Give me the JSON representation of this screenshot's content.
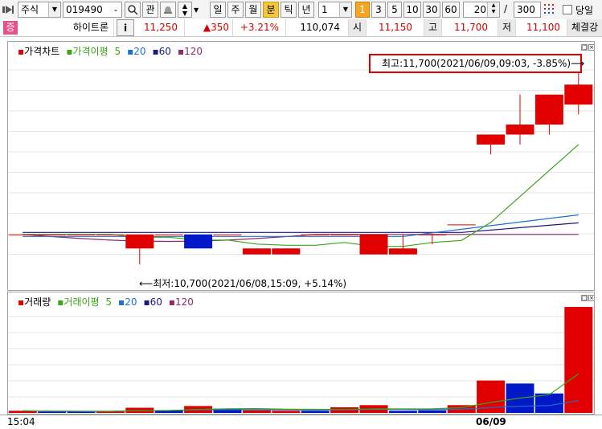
{
  "toolbar": {
    "market": "주식",
    "code": "019490",
    "watch_label": "관",
    "periods": [
      "일",
      "주",
      "월",
      "분",
      "틱",
      "년"
    ],
    "active_period": "분",
    "interval_value": "1",
    "quick_intervals": [
      "1",
      "3",
      "5",
      "10",
      "30",
      "60"
    ],
    "active_interval": "1",
    "count_value": "20",
    "slash": "/",
    "total_value": "300",
    "today_label": "당일"
  },
  "quote": {
    "badge": "증",
    "name": "하이트론",
    "info_label": "i",
    "price": "11,250",
    "change": "▲350",
    "change_pct": "+3.21%",
    "volume": "110,074",
    "open_label": "시",
    "open": "11,150",
    "high_label": "고",
    "high": "11,700",
    "low_label": "저",
    "low": "11,100",
    "exec_label": "체결강"
  },
  "price_panel": {
    "legend": {
      "title": "가격차트",
      "ma_title": "가격이평",
      "ma": [
        "5",
        "20",
        "60",
        "120"
      ]
    },
    "high_annotation": "최고:11,700(2021/06/09,09:03, -3.85%)⟶",
    "low_annotation": "⟵최저:10,700(2021/06/08,15:09, +5.14%)"
  },
  "volume_panel": {
    "legend": {
      "title": "거래량",
      "ma_title": "거래이평",
      "ma": [
        "5",
        "20",
        "60",
        "120"
      ]
    }
  },
  "footer": {
    "time_label": "15:04",
    "date_label": "06/09"
  },
  "colors": {
    "up": "#e00000",
    "down": "#0018c8",
    "ma5": "#3aa317",
    "ma20": "#1e6fd0",
    "ma60": "#1a1a7a",
    "ma120": "#8b2b6b"
  },
  "chart_data": {
    "type": "candlestick",
    "candles": [
      {
        "o": 10850,
        "h": 10850,
        "l": 10850,
        "c": 10850,
        "color": "up"
      },
      {
        "o": 10850,
        "h": 10850,
        "l": 10850,
        "c": 10850,
        "color": "up"
      },
      {
        "o": 10850,
        "h": 10850,
        "l": 10850,
        "c": 10850,
        "color": "up"
      },
      {
        "o": 10850,
        "h": 10850,
        "l": 10850,
        "c": 10850,
        "color": "up"
      },
      {
        "o": 10850,
        "h": 10850,
        "l": 10700,
        "c": 10780,
        "color": "up"
      },
      {
        "o": 10850,
        "h": 10850,
        "l": 10850,
        "c": 10850,
        "color": "up"
      },
      {
        "o": 10850,
        "h": 10850,
        "l": 10780,
        "c": 10780,
        "color": "down"
      },
      {
        "o": 10850,
        "h": 10850,
        "l": 10850,
        "c": 10850,
        "color": "up"
      },
      {
        "o": 10780,
        "h": 10780,
        "l": 10750,
        "c": 10750,
        "color": "up"
      },
      {
        "o": 10780,
        "h": 10780,
        "l": 10750,
        "c": 10750,
        "color": "up"
      },
      {
        "o": 10850,
        "h": 10850,
        "l": 10850,
        "c": 10850,
        "color": "up"
      },
      {
        "o": 10850,
        "h": 10850,
        "l": 10850,
        "c": 10850,
        "color": "up"
      },
      {
        "o": 10850,
        "h": 10850,
        "l": 10750,
        "c": 10750,
        "color": "up"
      },
      {
        "o": 10780,
        "h": 10850,
        "l": 10750,
        "c": 10750,
        "color": "up"
      },
      {
        "o": 10850,
        "h": 10850,
        "l": 10800,
        "c": 10850,
        "color": "up"
      },
      {
        "o": 10900,
        "h": 10900,
        "l": 10900,
        "c": 10900,
        "color": "up"
      },
      {
        "o": 11350,
        "h": 11350,
        "l": 11250,
        "c": 11300,
        "color": "up"
      },
      {
        "o": 11350,
        "h": 11550,
        "l": 11300,
        "c": 11400,
        "color": "up"
      },
      {
        "o": 11550,
        "h": 11550,
        "l": 11350,
        "c": 11400,
        "color": "up"
      },
      {
        "o": 11600,
        "h": 11700,
        "l": 11450,
        "c": 11500,
        "color": "up"
      }
    ],
    "volume": [
      5,
      3,
      3,
      4,
      12,
      6,
      16,
      10,
      6,
      5,
      5,
      13,
      18,
      5,
      6,
      18,
      75,
      68,
      45,
      245
    ],
    "volume_colors": [
      "up",
      "down",
      "down",
      "up",
      "up",
      "down",
      "up",
      "down",
      "up",
      "up",
      "down",
      "up",
      "up",
      "down",
      "down",
      "up",
      "up",
      "down",
      "down",
      "up"
    ],
    "y_range": [
      10600,
      11750
    ],
    "high": 11700,
    "low": 10700
  }
}
